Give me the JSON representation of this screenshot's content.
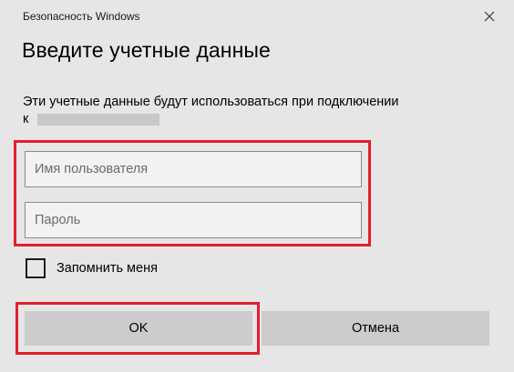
{
  "window": {
    "title": "Безопасность Windows",
    "close_icon": "close-icon"
  },
  "dialog": {
    "heading": "Введите учетные данные",
    "message": "Эти учетные данные будут использоваться при подключении",
    "target_prefix": "к"
  },
  "form": {
    "username": {
      "placeholder": "Имя пользователя",
      "value": ""
    },
    "password": {
      "placeholder": "Пароль",
      "value": ""
    },
    "remember": {
      "label": "Запомнить меня",
      "checked": false
    }
  },
  "buttons": {
    "ok_label": "OK",
    "cancel_label": "Отмена"
  },
  "colors": {
    "background": "#e6e6e6",
    "highlight": "#e0202e",
    "button": "#cccccc"
  }
}
